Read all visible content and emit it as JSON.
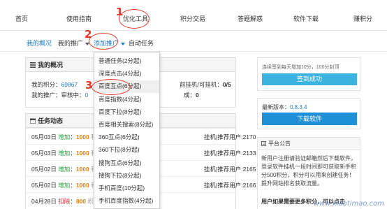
{
  "topnav": {
    "items": [
      "首页",
      "使用指南",
      "优化工具",
      "积分交易",
      "答题解惑",
      "软件下载",
      "赚积分"
    ]
  },
  "subnav": {
    "overview": "我的概况",
    "promo": "我的推广",
    "add_promo": "添加推广",
    "auto_task": "自动任务"
  },
  "overview_panel": {
    "title": "我的概况",
    "points_label": "我的积分：",
    "points_value": "69867",
    "promo_label": "我的推广：审核中：",
    "promo_value": "0",
    "right_label": "前挂机/可挂机：",
    "right_value": "0/5",
    "right2_label": "成：",
    "right2_value": "0"
  },
  "task_panel": {
    "title": "任务动态",
    "rows": [
      {
        "date": "05月03日",
        "type": "增加",
        "amount": "1000",
        "unit": "积分",
        "right": "挂机|推荐用户:2170",
        "neg": false
      },
      {
        "date": "05月03日",
        "type": "增加",
        "amount": "1000",
        "unit": "积分",
        "right": "挂机|推荐用户:2133",
        "neg": false
      },
      {
        "date": "05月02日",
        "type": "增加",
        "amount": "1000",
        "unit": "积分",
        "right": "挂机|推荐用户:2165",
        "neg": false
      },
      {
        "date": "05月02日",
        "type": "增加",
        "amount": "1000",
        "unit": "积分",
        "right": "挂机|推荐用户:2166",
        "neg": false
      },
      {
        "date": "04月28日",
        "type": "扣除",
        "amount": "800",
        "unit": "积分",
        "right": "",
        "neg": true
      }
    ]
  },
  "dropdown": {
    "items": [
      "普通任务(2分起)",
      "深度点击(4分起)",
      "百度互点(6分起)",
      "百度指数(4分起)",
      "百度下拉(8分起)",
      "百度相关搜索(8分起)",
      "360互点(6分起)",
      "360下拉(8分起)",
      "搜狗互点(6分起)",
      "搜狗下拉(8分起)",
      "手机百度(10分起)",
      "手机百度指数(4分起)"
    ]
  },
  "signin_panel": {
    "text": "连续签到每天增加10分，100分封顶",
    "button": "签到成功"
  },
  "version_panel": {
    "label": "最新版本：",
    "version": "0.8.3.4",
    "button": "下载软件"
  },
  "notice_panel": {
    "title": "平台公告",
    "body": "新用户注册请验证邮箱然后下载软件，登录软件挂机一段时间即可获取新手积分500积分，积分可以用来创建任务！提升网站排名获取流量。",
    "footer": "用户如果需要更多积分，可以点击"
  },
  "annotations": [
    "1",
    "2",
    "3"
  ],
  "watermark": "www.xiaotimao.com"
}
